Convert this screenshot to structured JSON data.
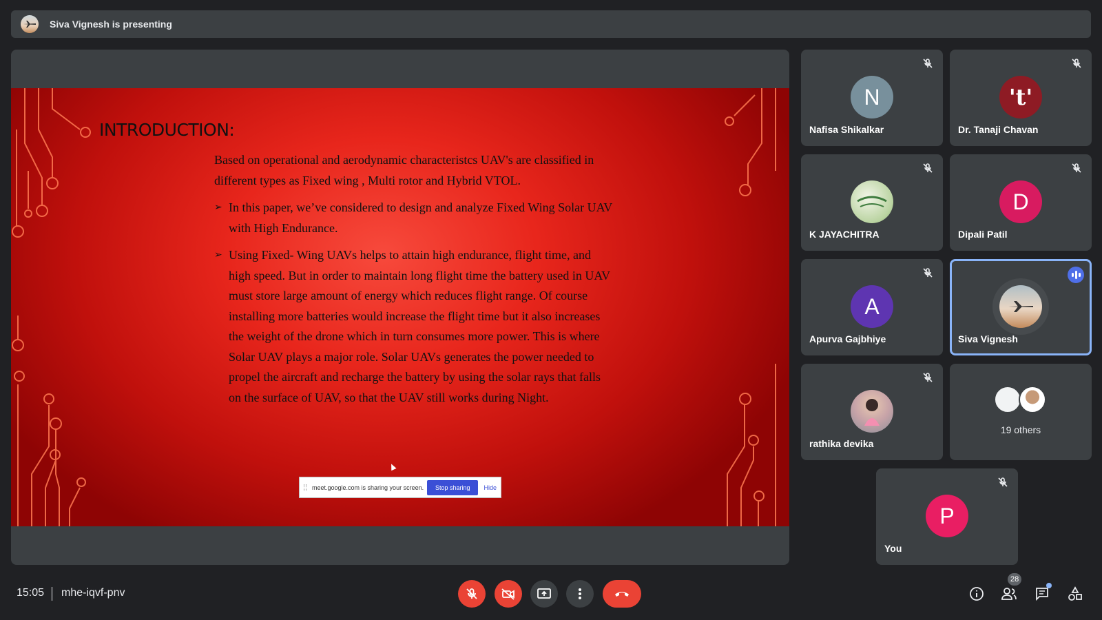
{
  "banner": {
    "text": "Siva Vignesh is presenting",
    "avatar_icon": "airplane-avatar"
  },
  "slide": {
    "title": "INTRODUCTION:",
    "paragraph": "Based on operational and aerodynamic characteristcs UAV's are classified in different types as Fixed wing , Multi rotor and Hybrid VTOL.",
    "bullets": [
      "In this paper, we’ve considered to design and analyze Fixed Wing Solar UAV with High Endurance.",
      "Using Fixed- Wing UAVs  helps to attain high endurance, flight time, and high speed. But in order to maintain long flight time the battery used in UAV must store large amount of energy which reduces flight range. Of course installing more batteries would increase the flight time but it also increases the weight of the drone which in turn consumes more power. This is where Solar UAV plays a major role. Solar UAVs generates the power needed to propel the aircraft and recharge the battery by using the solar rays that falls on the surface of UAV, so that the UAV still works during Night."
    ],
    "bullet_mark": "➢"
  },
  "share_bar": {
    "text": "meet.google.com is sharing your screen.",
    "stop": "Stop sharing",
    "hide": "Hide"
  },
  "participants": [
    {
      "name": "Nafisa Shikalkar",
      "initial": "N",
      "color": "#78909c",
      "muted": true
    },
    {
      "name": "Dr. Tanaji Chavan",
      "initial": "'t'",
      "color": "#8e1b24",
      "muted": true
    },
    {
      "name": "K JAYACHITRA",
      "initial": "",
      "color": "#dfe9d0",
      "muted": true
    },
    {
      "name": "Dipali Patil",
      "initial": "D",
      "color": "#d81b60",
      "muted": true
    },
    {
      "name": "Apurva Gajbhiye",
      "initial": "A",
      "color": "#5e35b1",
      "muted": true
    },
    {
      "name": "Siva Vignesh",
      "initial": "",
      "color": "#b0bec5",
      "muted": false,
      "speaking": true
    },
    {
      "name": "rathika devika",
      "initial": "",
      "color": "#c7a3a8",
      "muted": true
    }
  ],
  "others": {
    "label": "19 others"
  },
  "self": {
    "name": "You",
    "initial": "P",
    "color": "#e91e63",
    "muted": true
  },
  "bottom": {
    "time": "15:05",
    "meeting_code": "mhe-iqvf-pnv",
    "people_count": "28"
  },
  "colors": {
    "background": "#202124",
    "tile": "#3c4043",
    "danger": "#ea4335",
    "accent": "#8ab4f8"
  }
}
